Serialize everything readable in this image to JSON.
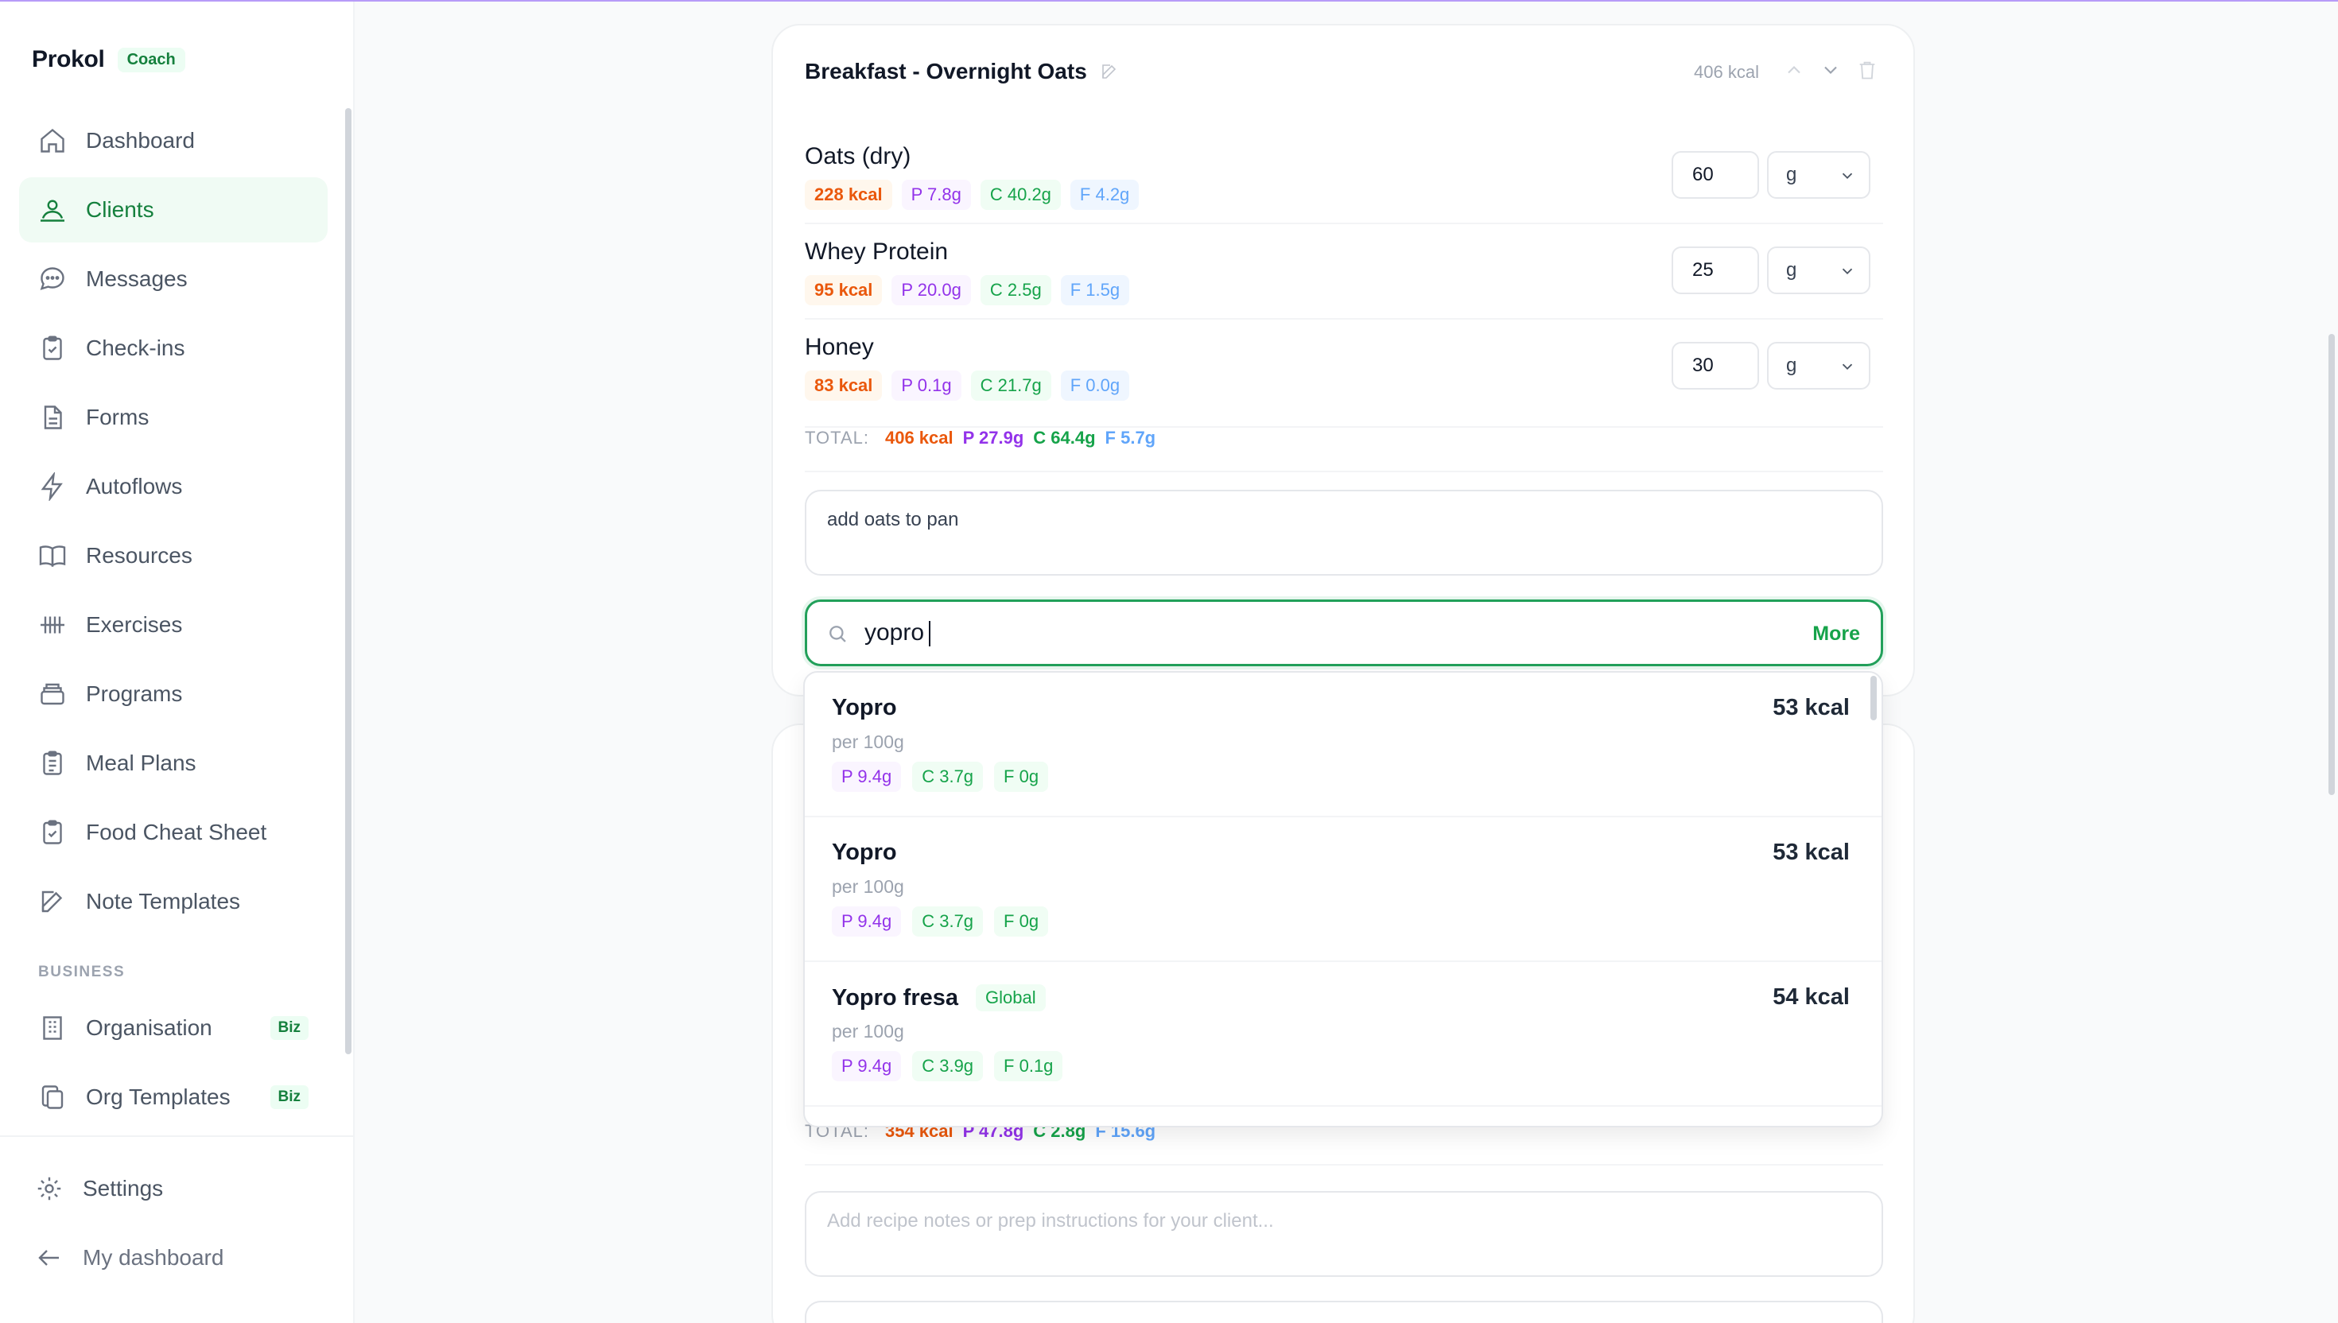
{
  "brand": {
    "name": "Prokol",
    "badge": "Coach"
  },
  "nav": [
    {
      "label": "Dashboard",
      "icon": "home-icon"
    },
    {
      "label": "Clients",
      "icon": "clients-icon",
      "active": true
    },
    {
      "label": "Messages",
      "icon": "message-icon"
    },
    {
      "label": "Check-ins",
      "icon": "clipboard-check-icon"
    },
    {
      "label": "Forms",
      "icon": "file-icon"
    },
    {
      "label": "Autoflows",
      "icon": "lightning-icon"
    },
    {
      "label": "Resources",
      "icon": "book-icon"
    },
    {
      "label": "Exercises",
      "icon": "dumbbell-icon"
    },
    {
      "label": "Programs",
      "icon": "stack-icon"
    },
    {
      "label": "Meal Plans",
      "icon": "clipboard-list-icon"
    },
    {
      "label": "Food Cheat Sheet",
      "icon": "clipboard-icon"
    },
    {
      "label": "Note Templates",
      "icon": "edit-icon"
    }
  ],
  "business": {
    "title": "BUSINESS",
    "items": [
      {
        "label": "Organisation",
        "badge": "Biz",
        "icon": "building-icon"
      },
      {
        "label": "Org Templates",
        "badge": "Biz",
        "icon": "copy-icon"
      }
    ]
  },
  "bottom_nav": [
    {
      "label": "Settings",
      "icon": "gear-icon"
    },
    {
      "label": "My dashboard",
      "icon": "arrow-left-icon"
    }
  ],
  "meal": {
    "title": "Breakfast - Overnight Oats",
    "kcal": "406 kcal",
    "foods": [
      {
        "name": "Oats (dry)",
        "kcal": "228 kcal",
        "p": "P 7.8g",
        "c": "C 40.2g",
        "f": "F 4.2g",
        "qty": "60",
        "unit": "g"
      },
      {
        "name": "Whey Protein",
        "kcal": "95 kcal",
        "p": "P 20.0g",
        "c": "C 2.5g",
        "f": "F 1.5g",
        "qty": "25",
        "unit": "g"
      },
      {
        "name": "Honey",
        "kcal": "83 kcal",
        "p": "P 0.1g",
        "c": "C 21.7g",
        "f": "F 0.0g",
        "qty": "30",
        "unit": "g"
      }
    ],
    "total": {
      "label": "TOTAL:",
      "kcal": "406 kcal",
      "p": "P 27.9g",
      "c": "C 64.4g",
      "f": "F 5.7g"
    },
    "notes": "add oats to pan",
    "search": {
      "value": "yopro",
      "more": "More"
    }
  },
  "search_results": [
    {
      "name": "Yopro",
      "per": "per 100g",
      "kcal": "53 kcal",
      "p": "P 9.4g",
      "c": "C 3.7g",
      "f": "F 0g",
      "global": ""
    },
    {
      "name": "Yopro",
      "per": "per 100g",
      "kcal": "53 kcal",
      "p": "P 9.4g",
      "c": "C 3.7g",
      "f": "F 0g",
      "global": ""
    },
    {
      "name": "Yopro fresa",
      "per": "per 100g",
      "kcal": "54 kcal",
      "p": "P 9.4g",
      "c": "C 3.9g",
      "f": "F 0.1g",
      "global": "Global"
    }
  ],
  "meal2": {
    "total": {
      "label": "TOTAL:",
      "kcal": "354 kcal",
      "p": "P 47.8g",
      "c": "C 2.8g",
      "f": "F 15.6g"
    },
    "notes_placeholder": "Add recipe notes or prep instructions for your client..."
  }
}
